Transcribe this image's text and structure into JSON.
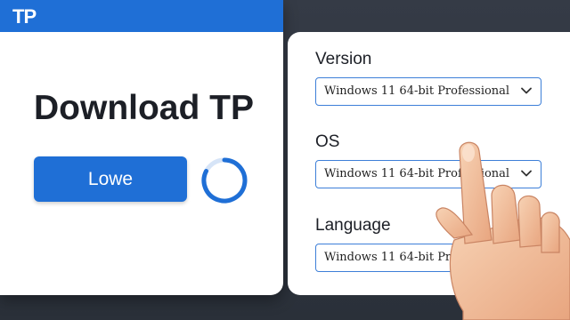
{
  "app": {
    "logo_text": "TP",
    "brand_color": "#1f6fd6"
  },
  "main": {
    "title": "Download TP",
    "primary_button_label": "Lowe"
  },
  "form": {
    "fields": [
      {
        "label": "Version",
        "value": "Windows 11 64-bit Professional"
      },
      {
        "label": "OS",
        "value": "Windows 11 64-bit Professional"
      },
      {
        "label": "Language",
        "value": "Windows 11 64-bit Professional"
      }
    ]
  },
  "icons": {
    "spinner": "loading-spinner-icon",
    "chevron": "chevron-down-icon",
    "pointer": "pointing-hand"
  }
}
